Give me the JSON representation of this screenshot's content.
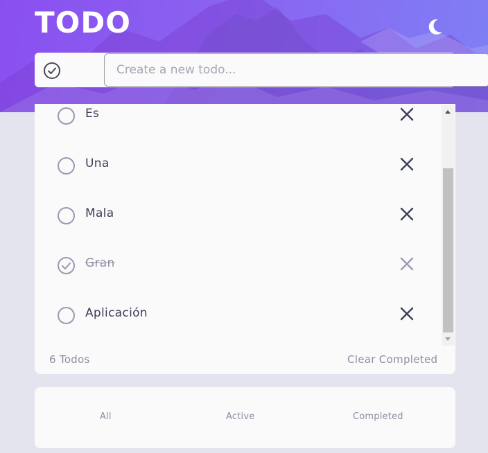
{
  "app": {
    "title": "TODO"
  },
  "header": {
    "theme_icon": "moon-icon"
  },
  "new_todo": {
    "placeholder": "Create a new todo..."
  },
  "todos": [
    {
      "text": "Es",
      "completed": false
    },
    {
      "text": "Una",
      "completed": false
    },
    {
      "text": "Mala",
      "completed": false
    },
    {
      "text": "Gran",
      "completed": true
    },
    {
      "text": "Aplicación",
      "completed": false
    }
  ],
  "footer": {
    "count_label": "6 Todos",
    "clear_label": "Clear Completed"
  },
  "filters": {
    "all": "All",
    "active": "Active",
    "completed": "Completed"
  },
  "colors": {
    "card": "#fafafa",
    "page_bg": "#e4e4ef",
    "text": "#3b3e58",
    "muted": "#8e8ea1",
    "gradient_start": "#8a4ff0",
    "gradient_end": "#7f7ff5"
  }
}
